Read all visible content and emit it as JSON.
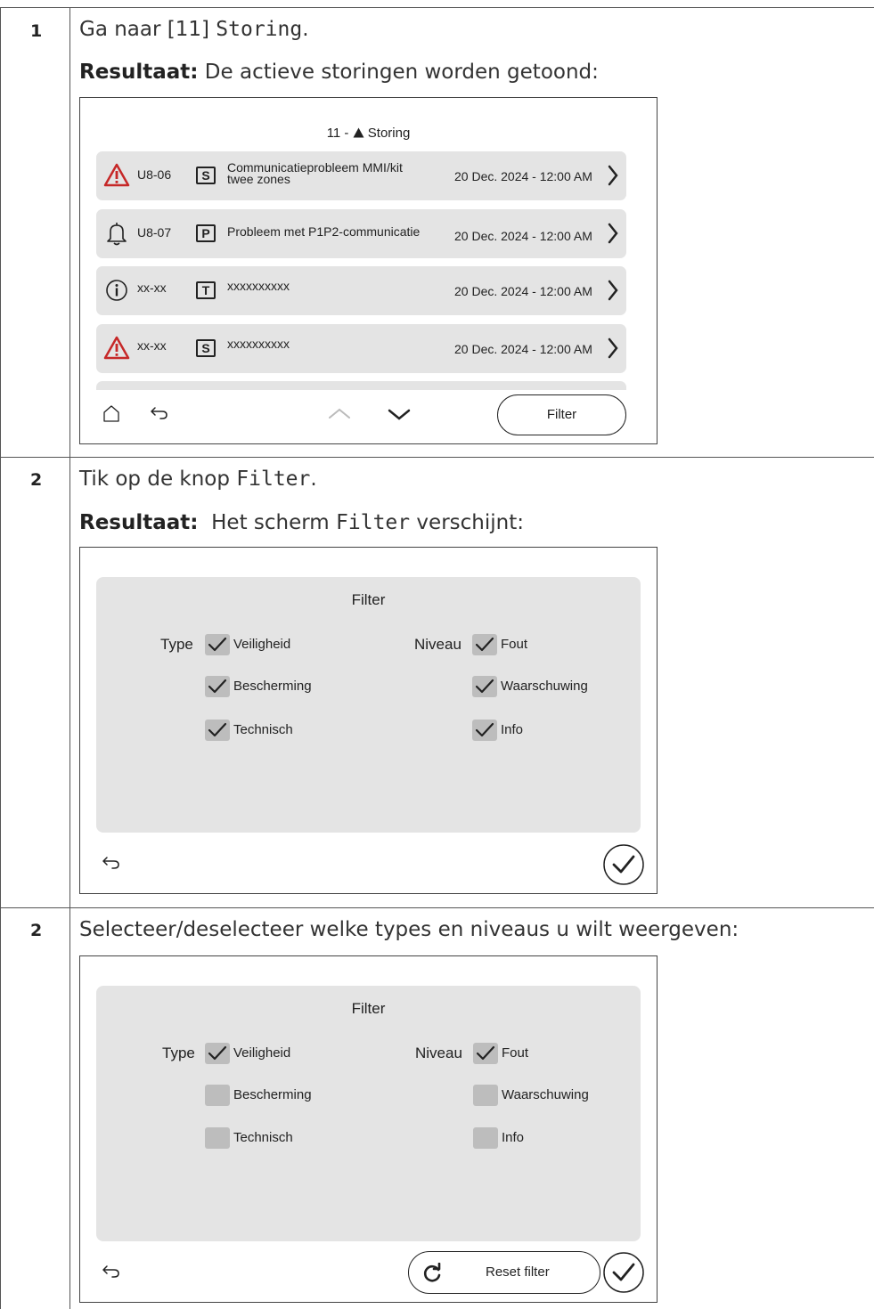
{
  "steps": [
    {
      "number": "1",
      "line1_prefix": "Ga naar [11] ",
      "line1_mono": "Storing",
      "line1_suffix": ".",
      "result_label": "Resultaat:",
      "result_text": " De actieve storingen worden getoond:"
    },
    {
      "number": "2",
      "line1_prefix": "Tik op de knop ",
      "line1_mono": "Filter",
      "line1_suffix": ".",
      "result_label": "Resultaat:",
      "result_text_prefix": "  Het scherm ",
      "result_mono": "Filter",
      "result_text_suffix": " verschijnt:"
    },
    {
      "number": "2",
      "line1": "Selecteer/deselecteer welke types en niveaus u wilt weergeven:"
    }
  ],
  "screen1": {
    "title_prefix": "11 - ",
    "title_text": "Storing",
    "rows": [
      {
        "icon": "warning-triangle-icon",
        "code": "U8-06",
        "level": "S",
        "desc": "Communicatieprobleem MMI/kit twee zones",
        "date": "20 Dec. 2024 - 12:00 AM"
      },
      {
        "icon": "bell-icon",
        "code": "U8-07",
        "level": "P",
        "desc": "Probleem met P1P2-communicatie",
        "date": "20 Dec. 2024 - 12:00 AM"
      },
      {
        "icon": "info-icon",
        "code": "xx-xx",
        "level": "T",
        "desc": "xxxxxxxxxx",
        "date": "20 Dec. 2024 - 12:00 AM"
      },
      {
        "icon": "warning-triangle-icon",
        "code": "xx-xx",
        "level": "S",
        "desc": "xxxxxxxxxx",
        "date": "20 Dec. 2024 - 12:00 AM"
      }
    ],
    "filter_button": "Filter"
  },
  "screen2": {
    "title": "Filter",
    "type_label": "Type",
    "niveau_label": "Niveau",
    "type_options": [
      {
        "label": "Veiligheid",
        "checked": true
      },
      {
        "label": "Bescherming",
        "checked": true
      },
      {
        "label": "Technisch",
        "checked": true
      }
    ],
    "niveau_options": [
      {
        "label": "Fout",
        "checked": true
      },
      {
        "label": "Waarschuwing",
        "checked": true
      },
      {
        "label": "Info",
        "checked": true
      }
    ]
  },
  "screen3": {
    "title": "Filter",
    "type_label": "Type",
    "niveau_label": "Niveau",
    "type_options": [
      {
        "label": "Veiligheid",
        "checked": true
      },
      {
        "label": "Bescherming",
        "checked": false
      },
      {
        "label": "Technisch",
        "checked": false
      }
    ],
    "niveau_options": [
      {
        "label": "Fout",
        "checked": true
      },
      {
        "label": "Waarschuwing",
        "checked": false
      },
      {
        "label": "Info",
        "checked": false
      }
    ],
    "reset_button": "Reset filter"
  },
  "colors": {
    "warning": "#c62828",
    "row_bg": "#e4e4e4",
    "checkbox_bg": "#bdbdbd"
  }
}
